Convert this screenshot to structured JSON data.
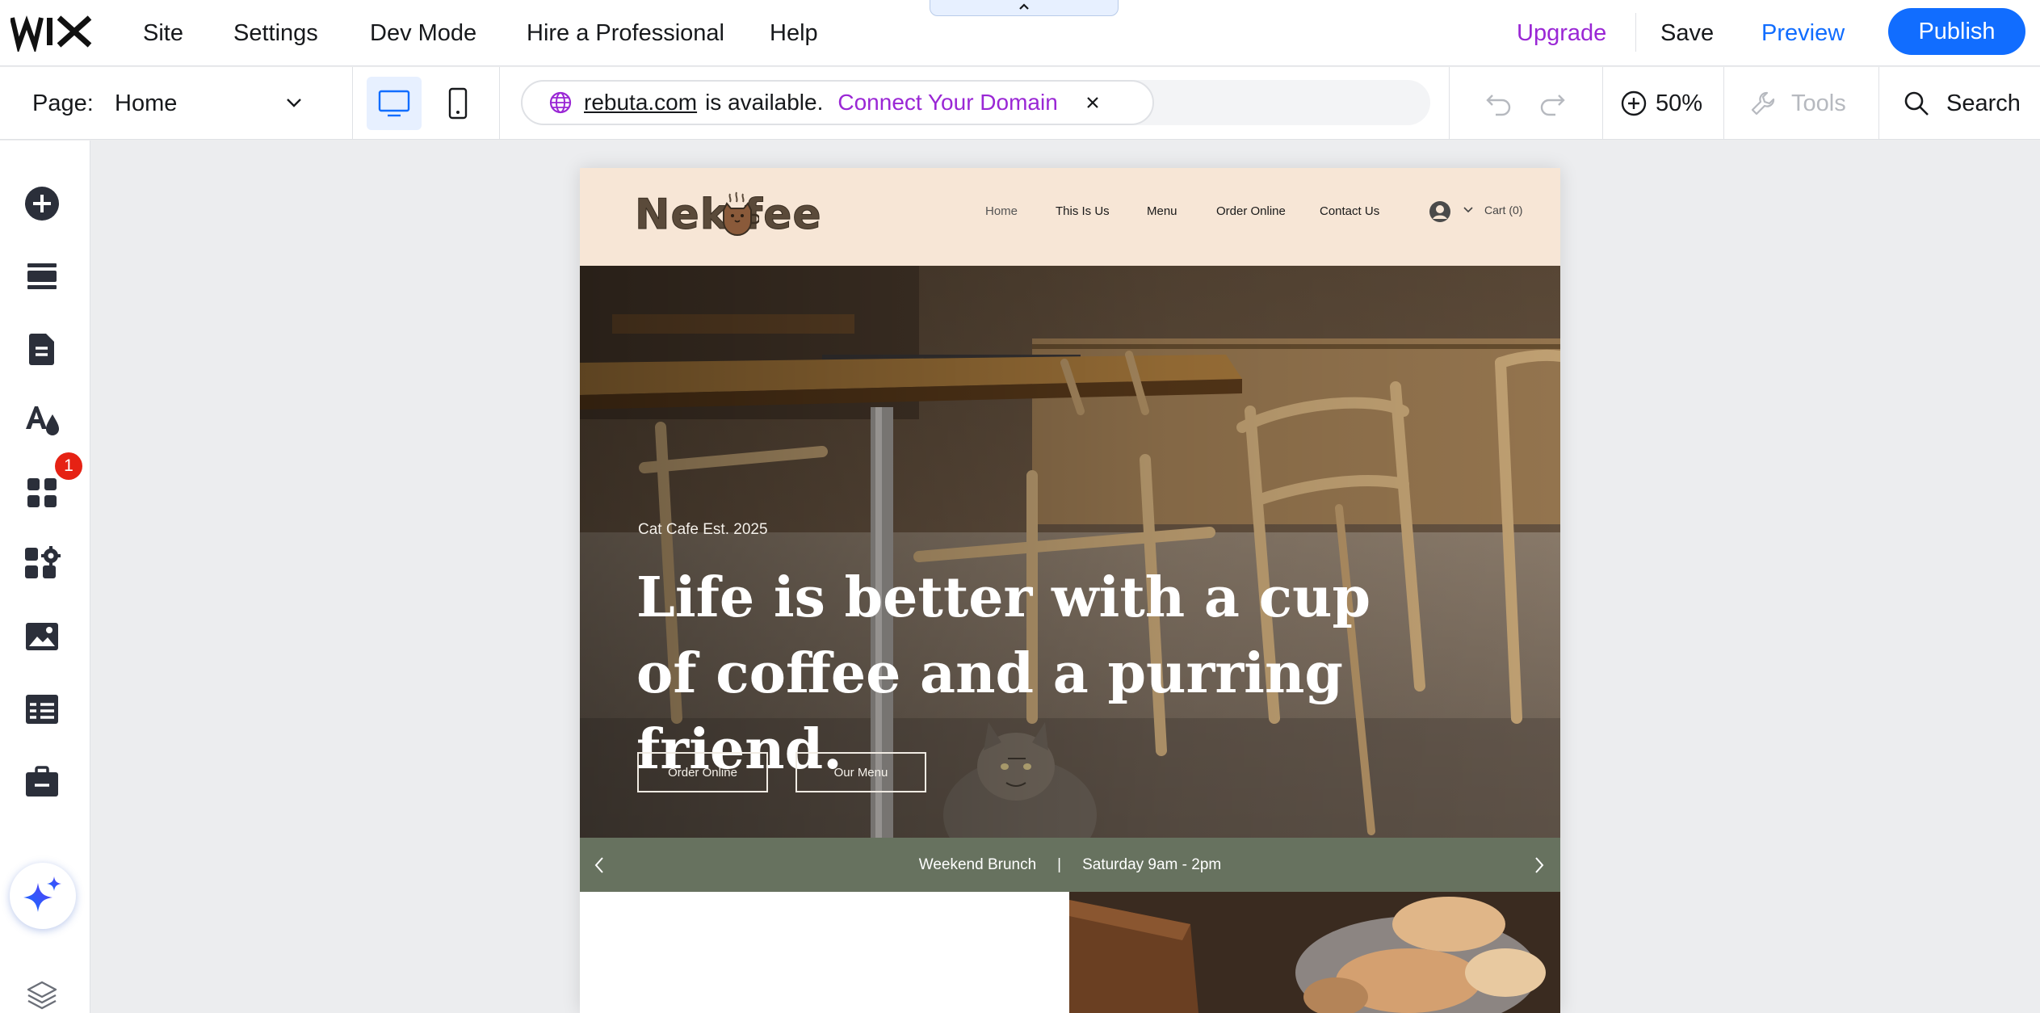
{
  "editor": {
    "brand": "WIX",
    "menu": {
      "site": "Site",
      "settings": "Settings",
      "dev_mode": "Dev Mode",
      "hire": "Hire a Professional",
      "help": "Help"
    },
    "actions": {
      "upgrade": "Upgrade",
      "save": "Save",
      "preview": "Preview",
      "publish": "Publish"
    },
    "colors": {
      "accent": "#116dff",
      "upgrade": "#9a27d5",
      "badge": "#e62214"
    }
  },
  "subbar": {
    "page_label": "Page:",
    "page_value": "Home",
    "domain": {
      "name": "rebuta.com",
      "status": "is available.",
      "cta": "Connect Your Domain"
    },
    "zoom": "50%",
    "tools": "Tools",
    "search": "Search"
  },
  "sidebar": {
    "items": [
      {
        "icon": "add-icon"
      },
      {
        "icon": "sections-icon"
      },
      {
        "icon": "pages-icon"
      },
      {
        "icon": "design-icon"
      },
      {
        "icon": "apps-icon",
        "badge": "1"
      },
      {
        "icon": "business-apps-icon"
      },
      {
        "icon": "media-icon"
      },
      {
        "icon": "cms-icon"
      },
      {
        "icon": "portfolio-icon"
      },
      {
        "icon": "ai-assistant-icon"
      },
      {
        "icon": "layers-icon"
      }
    ]
  },
  "site": {
    "logo_text": "Nek  fee",
    "nav": [
      "Home",
      "This Is Us",
      "Menu",
      "Order Online",
      "Contact Us"
    ],
    "cart": "Cart (0)",
    "hero": {
      "subtitle": "Cat Cafe Est. 2025",
      "title": "Life is better with a cup of coffee and a purring friend.",
      "buttons": [
        "Order Online",
        "Our Menu"
      ]
    },
    "banner": {
      "left": "Weekend Brunch",
      "divider": "|",
      "right": "Saturday 9am - 2pm"
    },
    "colors": {
      "header_bg": "#f7e6d6",
      "banner_bg": "#67725f"
    }
  }
}
